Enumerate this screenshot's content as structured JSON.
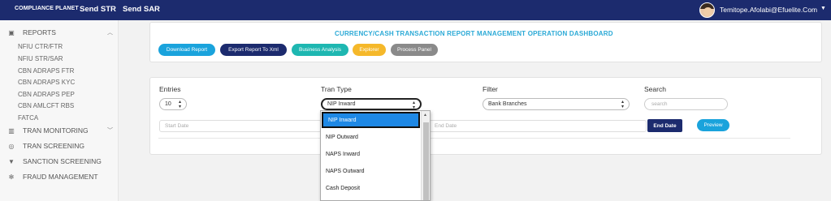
{
  "topbar": {
    "brand": "COMPLIANCE PLANET",
    "nav": [
      "Send STR",
      "Send SAR"
    ],
    "user": "Temitope.Afolabi@Efuelite.Com"
  },
  "sidebar": {
    "reports_label": "REPORTS",
    "report_items": [
      "NFIU CTR/FTR",
      "NFIU STR/SAR",
      "CBN ADRAPS FTR",
      "CBN ADRAPS KYC",
      "CBN ADRAPS PEP",
      "CBN AMLCFT RBS",
      "FATCA"
    ],
    "tran_monitoring": "TRAN MONITORING",
    "tran_screening": "TRAN SCREENING",
    "sanction_screening": "SANCTION SCREENING",
    "fraud_management": "FRAUD MANAGEMENT"
  },
  "dashboard": {
    "title": "CURRENCY/CASH TRANSACTION REPORT MANAGEMENT OPERATION DASHBOARD",
    "buttons": [
      "Download Report",
      "Export Report To Xml",
      "Business Analysis",
      "Explorer",
      "Process Panel"
    ],
    "button_colors": [
      "#1aa3dc",
      "#1c2b6e",
      "#1eb7b1",
      "#f5b82a",
      "#8a8a8a"
    ]
  },
  "filters": {
    "entries_label": "Entries",
    "entries_value": "10",
    "tran_type_label": "Tran Type",
    "tran_type_value": "NIP Inward",
    "filter_label": "Filter",
    "filter_value": "Bank Branches",
    "search_label": "Search",
    "search_placeholder": "search",
    "start_date_placeholder": "Start Date",
    "end_date_placeholder": "End Date",
    "end_date_button": "End Date",
    "preview_button": "Preview"
  },
  "dropdown": {
    "options": [
      "NIP Inward",
      "NIP Outward",
      "NAPS Inward",
      "NAPS Outward",
      "Cash Deposit"
    ],
    "selected": "NIP Inward"
  }
}
